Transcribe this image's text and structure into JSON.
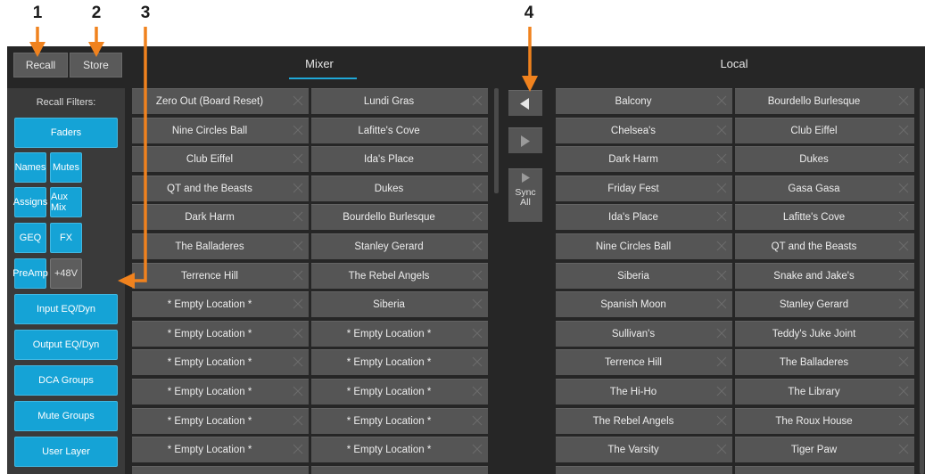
{
  "annotations": [
    "1",
    "2",
    "3",
    "4"
  ],
  "toolbar": {
    "recall_label": "Recall",
    "store_label": "Store"
  },
  "tabs": {
    "mixer": "Mixer",
    "local": "Local"
  },
  "filters": {
    "title": "Recall Filters:",
    "faders": "Faders",
    "names": "Names",
    "mutes": "Mutes",
    "assigns": "Assigns",
    "aux_mix": "Aux Mix",
    "geq": "GEQ",
    "fx": "FX",
    "preamp": "PreAmp",
    "phantom": "+48V",
    "input_eq": "Input EQ/Dyn",
    "output_eq": "Output EQ/Dyn",
    "dca_groups": "DCA Groups",
    "mute_groups": "Mute Groups",
    "user_layer": "User Layer"
  },
  "sync": {
    "left_arrow": "◀",
    "right_arrow": "▶",
    "sync_all_line1": "Sync",
    "sync_all_line2": "All"
  },
  "mixer_col1": [
    "Zero Out (Board Reset)",
    "Nine Circles Ball",
    "Club Eiffel",
    "QT and the Beasts",
    "Dark Harm",
    "The Balladeres",
    "Terrence Hill",
    "* Empty Location *",
    "* Empty Location *",
    "* Empty Location *",
    "* Empty Location *",
    "* Empty Location *",
    "* Empty Location *"
  ],
  "mixer_col2": [
    "Lundi Gras",
    "Lafitte's Cove",
    "Ida's Place",
    "Dukes",
    "Bourdello Burlesque",
    "Stanley Gerard",
    "The Rebel Angels",
    "Siberia",
    "* Empty Location *",
    "* Empty Location *",
    "* Empty Location *",
    "* Empty Location *",
    "* Empty Location *"
  ],
  "local_col1": [
    "Balcony",
    "Chelsea's",
    "Dark Harm",
    "Friday Fest",
    "Ida's Place",
    "Nine Circles Ball",
    "Siberia",
    "Spanish Moon",
    "Sullivan's",
    "Terrence Hill",
    "The Hi-Ho",
    "The Rebel Angels",
    "The Varsity"
  ],
  "local_col2": [
    "Bourdello Burlesque",
    "Club Eiffel",
    "Dukes",
    "Gasa Gasa",
    "Lafitte's Cove",
    "QT and the Beasts",
    "Snake and Jake's",
    "Stanley Gerard",
    "Teddy's Juke Joint",
    "The Balladeres",
    "The Library",
    "The Roux House",
    "Tiger Paw"
  ],
  "colors": {
    "accent": "#15a3d6",
    "annotation": "#f0821e",
    "background": "#262626"
  }
}
